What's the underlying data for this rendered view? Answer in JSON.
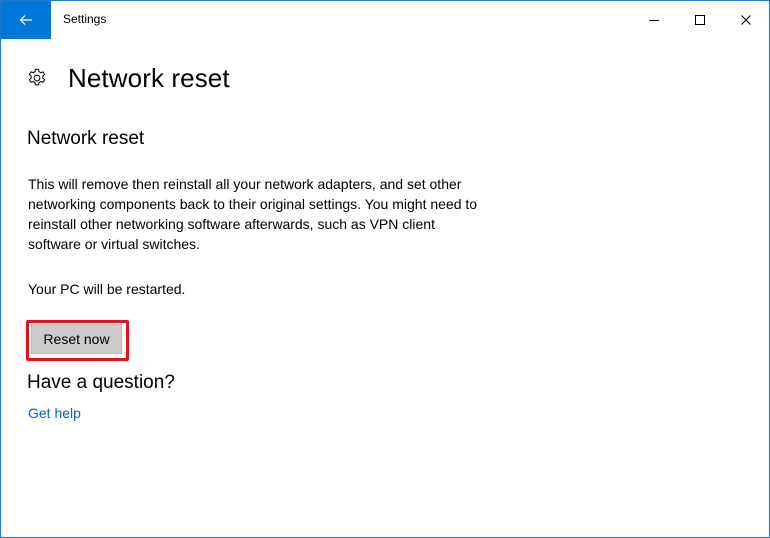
{
  "window": {
    "title": "Settings"
  },
  "header": {
    "icon": "gear-icon",
    "title": "Network reset"
  },
  "section": {
    "title": "Network reset",
    "description": "This will remove then reinstall all your network adapters, and set other networking components back to their original settings. You might need to reinstall other networking software afterwards, such as VPN client software or virtual switches.",
    "restart_note": "Your PC will be restarted.",
    "reset_button_label": "Reset now"
  },
  "help": {
    "title": "Have a question?",
    "link_label": "Get help"
  },
  "colors": {
    "accent": "#0078d7",
    "highlight": "#e8101d",
    "link": "#0066cc",
    "button_bg": "#cccccc"
  }
}
